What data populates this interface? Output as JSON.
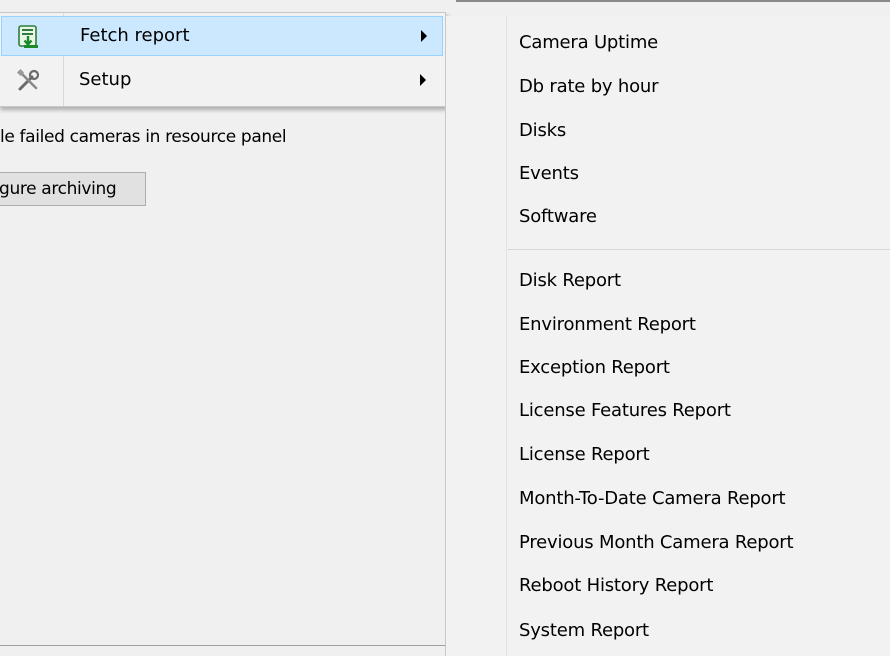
{
  "background": {
    "checkbox_text": "le failed cameras in resource panel",
    "button_label": "gure archiving"
  },
  "menu": {
    "items": [
      {
        "label": "Fetch report",
        "icon": "fetch-report-icon"
      },
      {
        "label": "Setup",
        "icon": "setup-tools-icon"
      }
    ]
  },
  "submenu": {
    "group1": [
      "Camera Uptime",
      "Db rate by hour",
      "Disks",
      "Events",
      "Software"
    ],
    "group2": [
      "Disk Report",
      "Environment Report",
      "Exception Report",
      "License Features Report",
      "License Report",
      "Month-To-Date Camera Report",
      "Previous Month Camera Report",
      "Reboot History Report",
      "System Report"
    ]
  },
  "colors": {
    "highlight_bg": "#cce8ff",
    "highlight_border": "#99d1ff",
    "menu_bg": "#f2f2f2"
  }
}
